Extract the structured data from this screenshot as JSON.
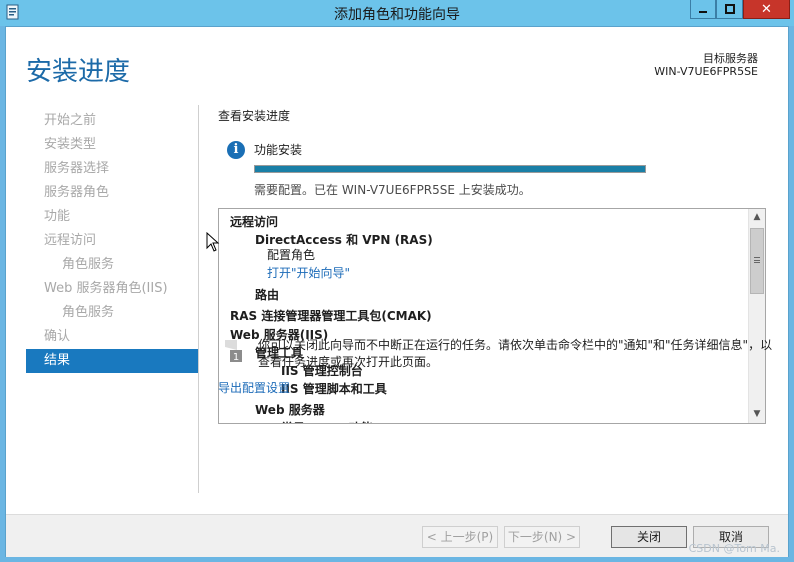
{
  "window": {
    "title": "添加角色和功能向导",
    "min_label": "▁",
    "max_label": "□",
    "close_label": "✕"
  },
  "page": {
    "title": "安装进度",
    "server_label": "目标服务器",
    "server_name": "WIN-V7UE6FPR5SE"
  },
  "nav": {
    "items": [
      {
        "label": "开始之前",
        "level": 0,
        "active": false
      },
      {
        "label": "安装类型",
        "level": 0,
        "active": false
      },
      {
        "label": "服务器选择",
        "level": 0,
        "active": false
      },
      {
        "label": "服务器角色",
        "level": 0,
        "active": false
      },
      {
        "label": "功能",
        "level": 0,
        "active": false
      },
      {
        "label": "远程访问",
        "level": 0,
        "active": false
      },
      {
        "label": "角色服务",
        "level": 1,
        "active": false
      },
      {
        "label": "Web 服务器角色(IIS)",
        "level": 0,
        "active": false
      },
      {
        "label": "角色服务",
        "level": 1,
        "active": false
      },
      {
        "label": "确认",
        "level": 0,
        "active": false
      },
      {
        "label": "结果",
        "level": 0,
        "active": true
      }
    ]
  },
  "progress": {
    "section_label": "查看安装进度",
    "feature_label": "功能安装",
    "percent": 100,
    "status": "需要配置。已在 WIN-V7UE6FPR5SE 上安装成功。"
  },
  "results": {
    "items": [
      {
        "text": "远程访问",
        "indent": 0,
        "bold": true,
        "link": false
      },
      {
        "text": "DirectAccess 和 VPN (RAS)",
        "indent": 1,
        "bold": true,
        "link": false
      },
      {
        "text": "配置角色",
        "indent": 2,
        "bold": false,
        "link": false
      },
      {
        "text": "打开\"开始向导\"",
        "indent": 2,
        "bold": false,
        "link": true
      },
      {
        "text": "路由",
        "indent": 1,
        "bold": true,
        "link": false
      },
      {
        "text": "RAS 连接管理器管理工具包(CMAK)",
        "indent": 0,
        "bold": true,
        "link": false
      },
      {
        "text": "Web 服务器(IIS)",
        "indent": 0,
        "bold": true,
        "link": false
      },
      {
        "text": "管理工具",
        "indent": 1,
        "bold": true,
        "link": false
      },
      {
        "text": "IIS 管理控制台",
        "indent": 2,
        "bold": true,
        "link": false
      },
      {
        "text": "IIS 管理脚本和工具",
        "indent": 2,
        "bold": true,
        "link": false
      },
      {
        "text": "Web 服务器",
        "indent": 1,
        "bold": true,
        "link": false
      },
      {
        "text": "常见 HTTP 功能",
        "indent": 2,
        "bold": true,
        "link": false
      }
    ]
  },
  "note": {
    "text": "你可以关闭此向导而不中断正在运行的任务。请依次单击命令栏中的\"通知\"和\"任务详细信息\"，以查看任务进度或再次打开此页面。",
    "icon_number": "1"
  },
  "export_link": "导出配置设置",
  "footer": {
    "prev": "< 上一步(P)",
    "next": "下一步(N) >",
    "close": "关闭",
    "cancel": "取消"
  },
  "watermark": "CSDN @Tom Ma.",
  "colors": {
    "accent": "#1979bf",
    "title_bar": "#6cc3ea",
    "close_button": "#c7352a",
    "progress_fill": "#1a7fa6",
    "link": "#1c6bb8"
  }
}
